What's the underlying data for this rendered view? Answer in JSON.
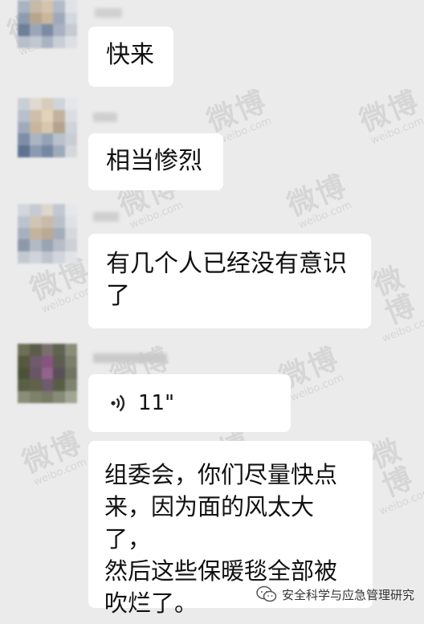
{
  "messages": [
    {
      "type": "text",
      "text": "快来"
    },
    {
      "type": "text",
      "text": "相当惨烈"
    },
    {
      "type": "text",
      "text": "有几个人已经没有意识\n了"
    },
    {
      "type": "voice",
      "duration": "11\""
    },
    {
      "type": "text",
      "text": "组委会，你们尽量快点\n来，因为面的风太大了，\n然后这些保暖毯全部被\n吹烂了。"
    }
  ],
  "watermark": {
    "main": "微博",
    "sub": "weibo.com"
  },
  "credit": {
    "text": "安全科学与应急管理研究"
  },
  "icons": {
    "voice": "voice-wave-icon",
    "credit": "wechat-icon"
  },
  "colors": {
    "background": "#ebebeb",
    "bubble": "#ffffff",
    "text": "#111111"
  }
}
